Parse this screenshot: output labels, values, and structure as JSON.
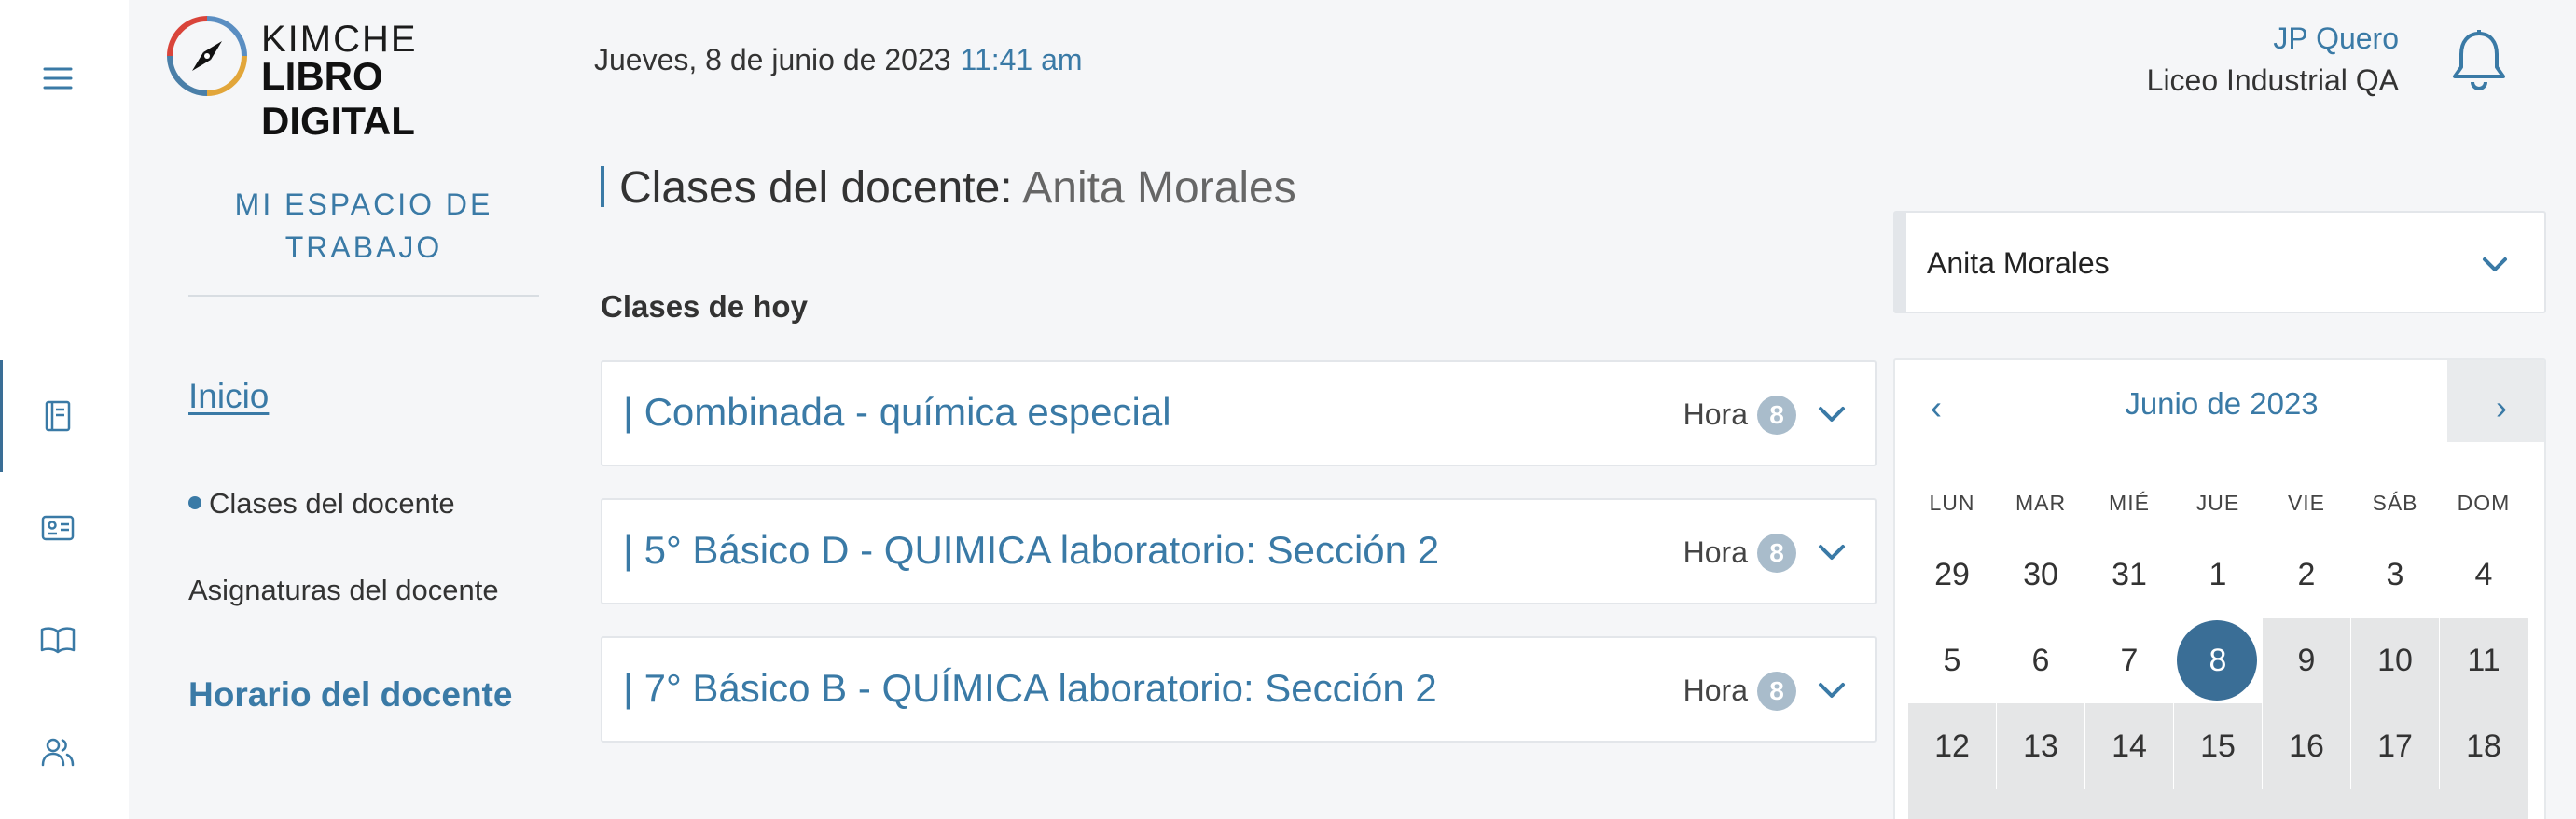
{
  "header": {
    "logo_top": "KIMCHE",
    "logo_bottom": "LIBRO DIGITAL",
    "date": "Jueves, 8 de junio de 2023",
    "time": "11:41 am",
    "user_name": "JP Quero",
    "school": "Liceo Industrial QA"
  },
  "rail": {
    "icons": [
      "menu-icon",
      "book-icon",
      "id-card-icon",
      "open-book-icon",
      "users-icon"
    ]
  },
  "sidebar": {
    "title": "MI ESPACIO DE TRABAJO",
    "inicio": "Inicio",
    "sub_items": [
      "Clases del docente",
      "Asignaturas del docente"
    ],
    "horario": "Horario del docente"
  },
  "main": {
    "title_prefix": "Clases del docente:",
    "teacher": "Anita Morales",
    "section": "Clases de hoy",
    "classes": [
      {
        "name": "| Combinada - química especial",
        "hora_label": "Hora",
        "hora": "8"
      },
      {
        "name": "| 5° Básico D - QUIMICA laboratorio: Sección 2",
        "hora_label": "Hora",
        "hora": "8"
      },
      {
        "name": "| 7° Básico B - QUÍMICA laboratorio: Sección 2",
        "hora_label": "Hora",
        "hora": "8"
      }
    ]
  },
  "teacher_select": {
    "value": "Anita Morales"
  },
  "calendar": {
    "prev": "‹",
    "next": "›",
    "month": "Junio de 2023",
    "weekdays": [
      "LUN",
      "MAR",
      "MIÉ",
      "JUE",
      "VIE",
      "SÁB",
      "DOM"
    ],
    "weeks": [
      [
        "29",
        "30",
        "31",
        "1",
        "2",
        "3",
        "4"
      ],
      [
        "5",
        "6",
        "7",
        "8",
        "9",
        "10",
        "11"
      ],
      [
        "12",
        "13",
        "14",
        "15",
        "16",
        "17",
        "18"
      ]
    ],
    "selected": "8"
  },
  "colors": {
    "accent": "#3a7aa6",
    "selected": "#3a6e96",
    "disabled_bg": "#e5e6e7"
  }
}
